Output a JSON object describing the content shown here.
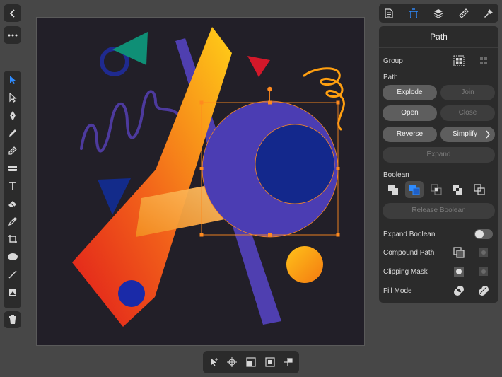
{
  "app": {
    "accent": "#2f8cff",
    "selection_color": "#ff8a1e"
  },
  "left_toolbar": {
    "back_icon": "chevron-left-icon",
    "more_icon": "ellipsis-icon",
    "tools": [
      "move-tool-icon",
      "node-tool-icon",
      "pen-tool-icon",
      "pencil-tool-icon",
      "vector-brush-icon",
      "fill-tool-icon",
      "text-tool-icon",
      "eraser-tool-icon",
      "color-picker-icon",
      "crop-tool-icon",
      "ellipse-tool-icon",
      "line-tool-icon",
      "place-image-icon"
    ],
    "active_tool": "move-tool-icon",
    "delete_icon": "trash-icon"
  },
  "studio_tabs": {
    "items": [
      "document-icon",
      "transform-icon",
      "layers-icon",
      "ruler-icon",
      "brush-icon"
    ],
    "active": "transform-icon"
  },
  "path_panel": {
    "title": "Path",
    "group_label": "Group",
    "path_label": "Path",
    "explode": "Explode",
    "join": "Join",
    "open": "Open",
    "close": "Close",
    "reverse": "Reverse",
    "simplify": "Simplify",
    "expand": "Expand",
    "boolean_label": "Boolean",
    "boolean_ops": [
      "add",
      "subtract",
      "intersect",
      "xor",
      "divide"
    ],
    "boolean_active": "subtract",
    "release_boolean": "Release Boolean",
    "expand_boolean": "Expand Boolean",
    "expand_boolean_on": false,
    "compound_path": "Compound Path",
    "clipping_mask": "Clipping Mask",
    "fill_mode": "Fill Mode"
  },
  "bottom_bar": {
    "items": [
      "select-arrow-icon",
      "target-icon",
      "align-icon",
      "center-icon",
      "flag-icon"
    ]
  }
}
